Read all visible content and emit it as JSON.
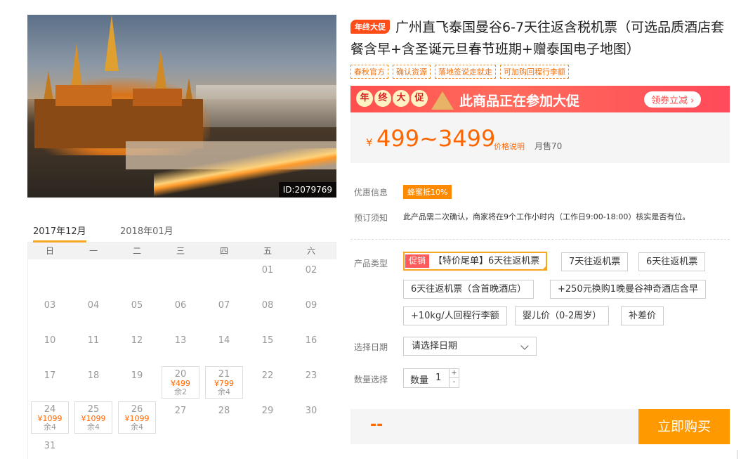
{
  "hero": {
    "image_id": "ID:2079769"
  },
  "calendar": {
    "tabs": [
      "2017年12月",
      "2018年01月"
    ],
    "weekdays": [
      "日",
      "一",
      "二",
      "三",
      "四",
      "五",
      "六"
    ],
    "cells": [
      {
        "d": ""
      },
      {
        "d": ""
      },
      {
        "d": ""
      },
      {
        "d": ""
      },
      {
        "d": ""
      },
      {
        "d": "01"
      },
      {
        "d": "02"
      },
      {
        "d": "03"
      },
      {
        "d": "04"
      },
      {
        "d": "05"
      },
      {
        "d": "06"
      },
      {
        "d": "07"
      },
      {
        "d": "08"
      },
      {
        "d": "09"
      },
      {
        "d": "10"
      },
      {
        "d": "11"
      },
      {
        "d": "12"
      },
      {
        "d": "13"
      },
      {
        "d": "14"
      },
      {
        "d": "15"
      },
      {
        "d": "16"
      },
      {
        "d": "17"
      },
      {
        "d": "18"
      },
      {
        "d": "19"
      },
      {
        "d": "20",
        "p": "¥499",
        "s": "余2"
      },
      {
        "d": "21",
        "p": "¥799",
        "s": "余4"
      },
      {
        "d": "22"
      },
      {
        "d": "23"
      },
      {
        "d": "24",
        "p": "¥1099",
        "s": "余4"
      },
      {
        "d": "25",
        "p": "¥1099",
        "s": "余4"
      },
      {
        "d": "26",
        "p": "¥1099",
        "s": "余4"
      },
      {
        "d": "27"
      },
      {
        "d": "28"
      },
      {
        "d": "29"
      },
      {
        "d": "30"
      },
      {
        "d": "31"
      }
    ]
  },
  "product": {
    "promo_tag": "年终大促",
    "title": "广州直飞泰国曼谷6-7天往返含税机票（可选品质酒店套餐含早+含圣诞元旦春节班期+赠泰国电子地图）",
    "badges": [
      "春秋官方",
      "确认资源",
      "落地签说走就走",
      "可加购回程行李额"
    ]
  },
  "banner": {
    "chars": [
      "年",
      "终",
      "大",
      "促"
    ],
    "text": "此商品正在参加大促",
    "coupon_button": "领券立减 ›"
  },
  "price": {
    "yen": "¥",
    "range": "499~3499",
    "explain": "价格说明",
    "sold": "月售70"
  },
  "info": {
    "discount_label": "优惠信息",
    "discount_tag": "蜂蜜抵10%",
    "notice_label": "预订须知",
    "notice_text": "此产品需二次确认，商家将在9个工作小时内（工作日9:00-18:00）核实是否有位。"
  },
  "options": {
    "label": "产品类型",
    "sale_tag": "促销",
    "items": [
      "【特价尾单】6天往返机票",
      "7天往返机票",
      "6天往返机票",
      "6天往返机票（含首晚酒店）",
      "+250元换购1晚曼谷神奇酒店含早",
      "+10kg/人回程行李额",
      "婴儿价（0-2周岁）",
      "补差价"
    ]
  },
  "date": {
    "label": "选择日期",
    "placeholder": "请选择日期"
  },
  "quantity": {
    "label": "数量选择",
    "inner_label": "数量",
    "value": "1",
    "plus": "+",
    "minus": "-"
  },
  "buy": {
    "total": "--",
    "button": "立即购买"
  },
  "colors": {
    "accent": "#ff6600",
    "buy": "#ff9900",
    "banner": "#ff4f4f",
    "selected_border": "#f5a623"
  }
}
